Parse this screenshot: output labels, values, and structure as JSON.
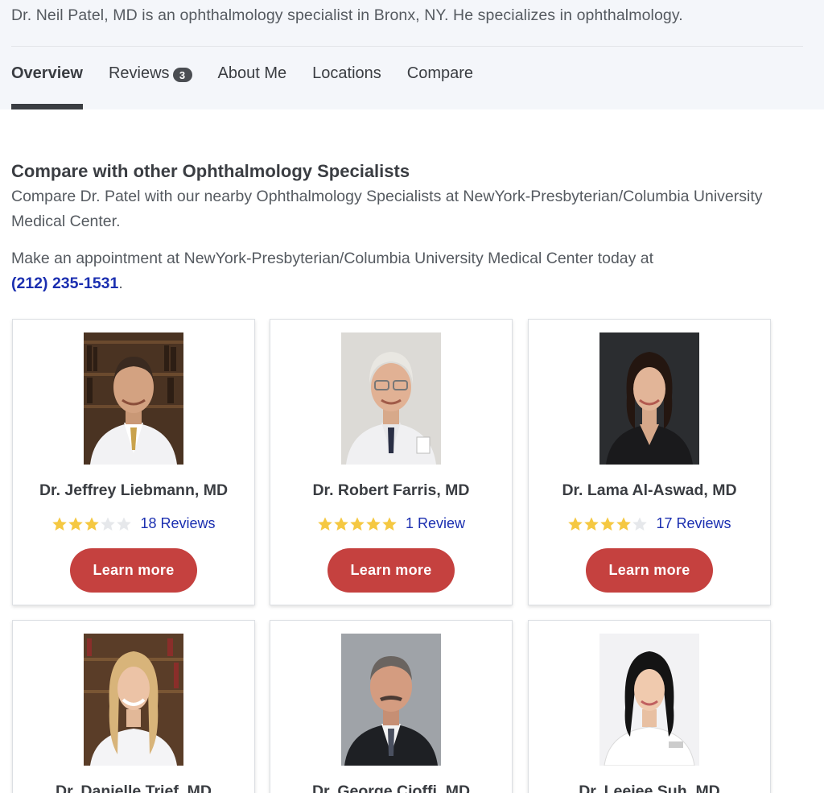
{
  "intro_text": "Dr. Neil Patel, MD is an ophthalmology specialist in Bronx, NY. He specializes in ophthalmology.",
  "tabs": [
    {
      "label": "Overview",
      "active": true
    },
    {
      "label": "Reviews",
      "badge": "3"
    },
    {
      "label": "About Me"
    },
    {
      "label": "Locations"
    },
    {
      "label": "Compare"
    }
  ],
  "compare": {
    "title": "Compare with other Ophthalmology Specialists",
    "description": "Compare Dr. Patel with our nearby Ophthalmology Specialists at NewYork-Presbyterian/Columbia University Medical Center.",
    "appointment_text": "Make an appointment at NewYork-Presbyterian/Columbia University Medical Center today at",
    "phone": "(212) 235-1531",
    "phone_suffix": "."
  },
  "doctors": [
    {
      "name": "Dr. Jeffrey Liebmann, MD",
      "rating": 3,
      "reviews": "18 Reviews",
      "button": "Learn more"
    },
    {
      "name": "Dr. Robert Farris, MD",
      "rating": 5,
      "reviews": "1 Review",
      "button": "Learn more"
    },
    {
      "name": "Dr. Lama Al-Aswad, MD",
      "rating": 4,
      "reviews": "17 Reviews",
      "button": "Learn more"
    },
    {
      "name": "Dr. Danielle Trief, MD"
    },
    {
      "name": "Dr. George Cioffi, MD"
    },
    {
      "name": "Dr. Leejee Suh, MD"
    }
  ],
  "colors": {
    "accent_button": "#c5413f",
    "link": "#1b2fb0",
    "star_filled": "#f5c842",
    "star_empty": "#e6e8eb"
  }
}
